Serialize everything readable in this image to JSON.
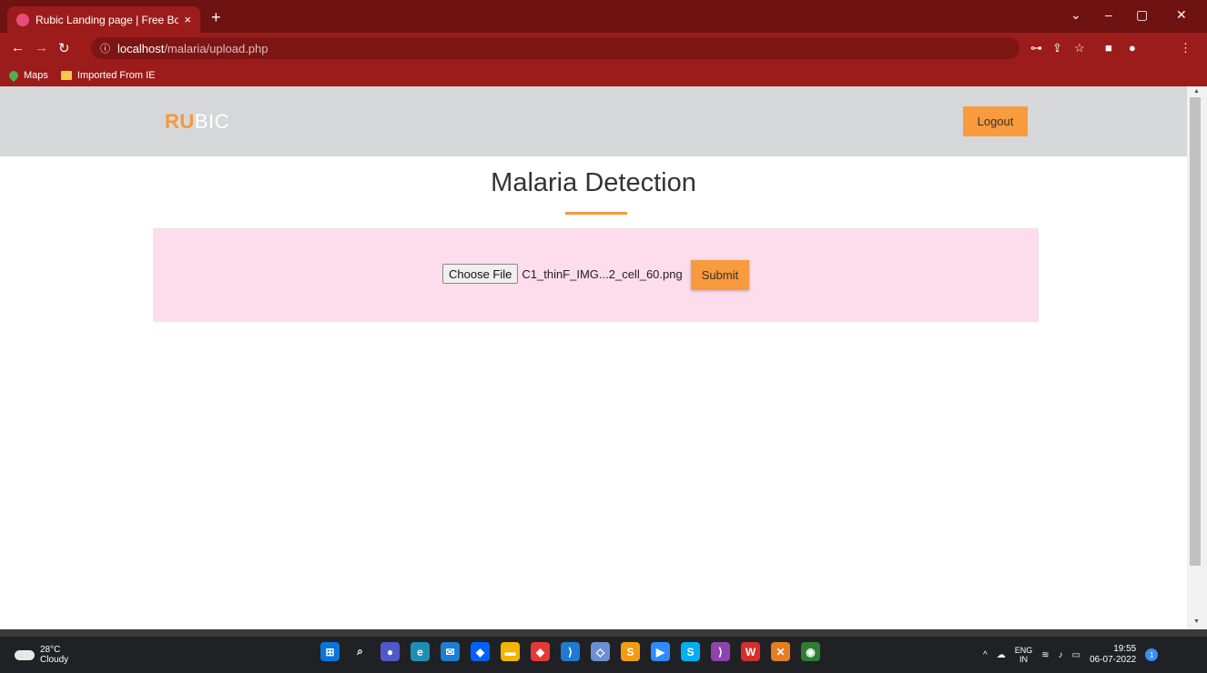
{
  "browser": {
    "tab_title": "Rubic Landing page | Free Bootst",
    "tab_close": "×",
    "new_tab": "+",
    "win_minimize": "–",
    "win_maximize": "▢",
    "win_close": "✕",
    "win_menu": "⌄",
    "url_host": "localhost",
    "url_path": "/malaria/upload.php",
    "bookmarks": [
      {
        "label": "Maps",
        "icon": "maps-icon"
      },
      {
        "label": "Imported From IE",
        "icon": "folder-icon"
      }
    ]
  },
  "site": {
    "logo_part1": "RU",
    "logo_part2": "BIC",
    "logout_label": "Logout",
    "heading": "Malaria Detection",
    "choose_file_label": "Choose File",
    "file_name": "C1_thinF_IMG...2_cell_60.png",
    "submit_label": "Submit"
  },
  "taskbar": {
    "temperature": "28°C",
    "weather": "Cloudy",
    "lang_line1": "ENG",
    "lang_line2": "IN",
    "time": "19:55",
    "date": "06-07-2022",
    "notification_count": "1"
  },
  "colors": {
    "browser_frame": "#8b1a1a",
    "nav_bg": "#d6d7d9",
    "accent": "#f89a3e",
    "upload_bg": "#fddcec"
  }
}
